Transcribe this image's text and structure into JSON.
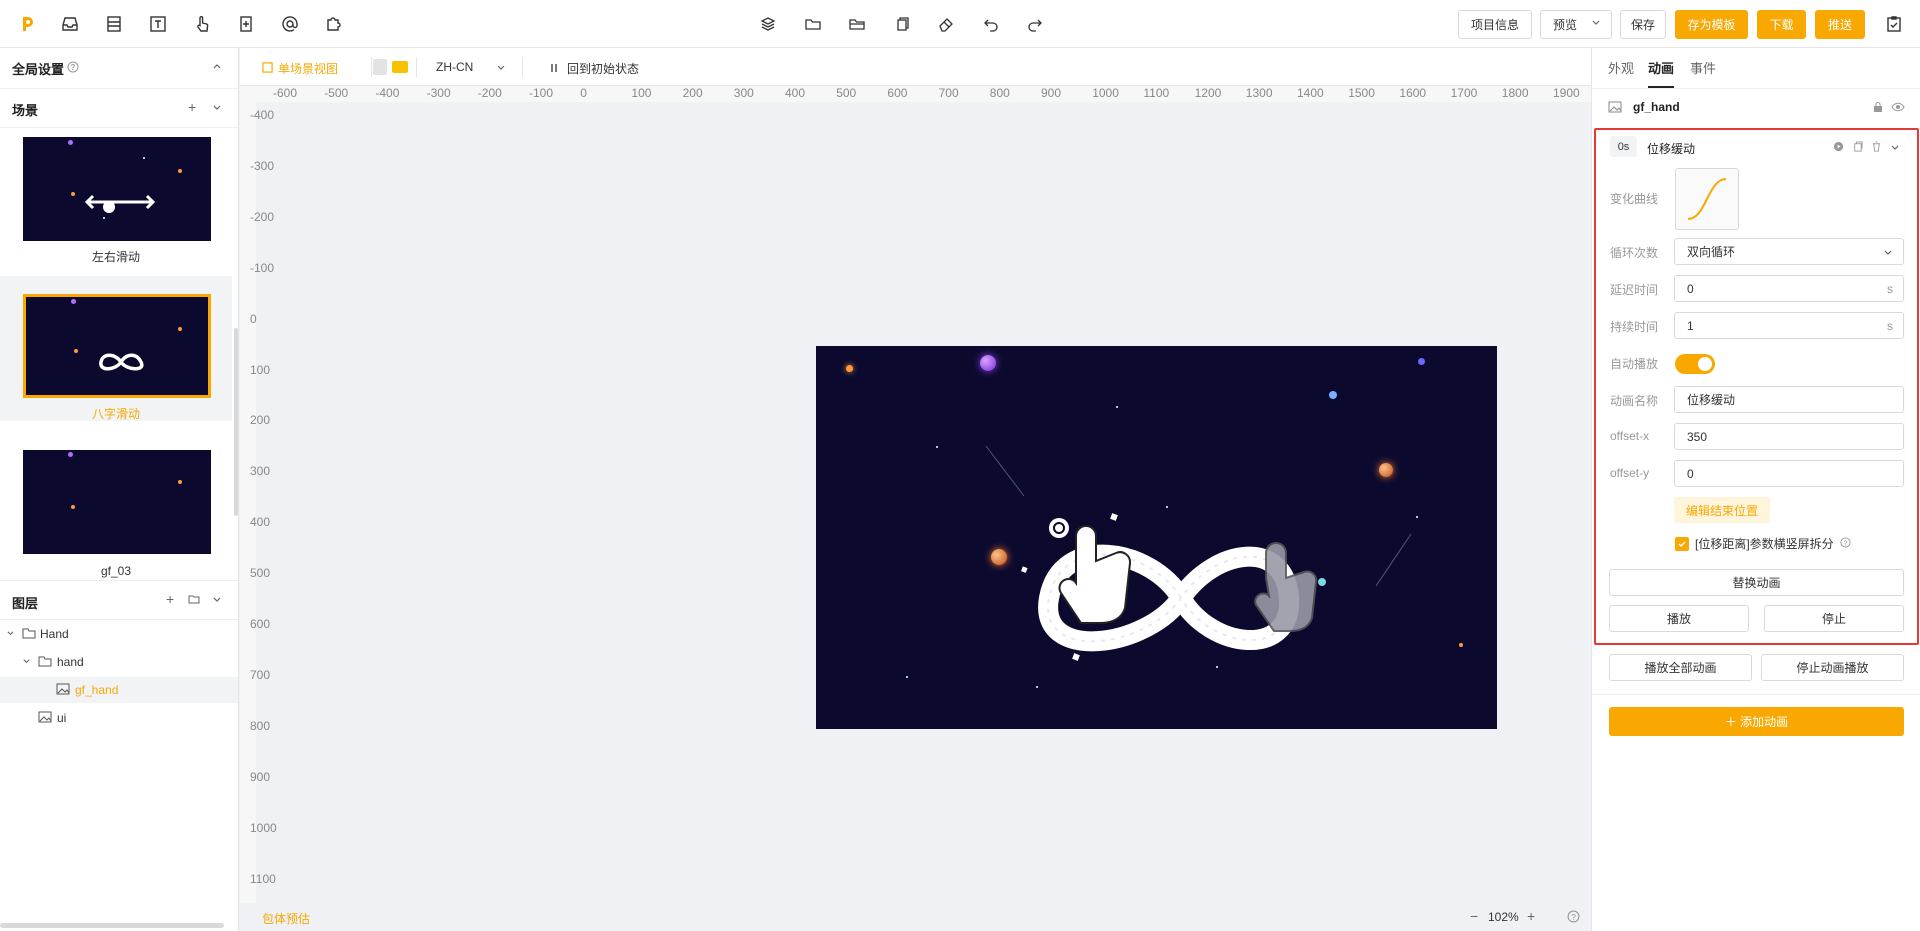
{
  "toolbar": {
    "left_icons": [
      "logo-icon",
      "inbox-icon",
      "layout-icon",
      "text-icon",
      "hand-pointer-icon",
      "add-file-icon",
      "at-icon",
      "puzzle-icon"
    ],
    "center_icons": [
      "layers-icon",
      "folder-icon",
      "folder-open-icon",
      "copy-icon",
      "eraser-icon",
      "undo-icon",
      "redo-icon"
    ],
    "project_info": "项目信息",
    "preview": "预览",
    "save": "保存",
    "save_template": "存为模板",
    "download": "下载",
    "push": "推送",
    "accent": "#f8a800"
  },
  "left": {
    "global_settings": "全局设置",
    "scenes_title": "场景",
    "scenes": [
      {
        "label": "左右滑动"
      },
      {
        "label": "八字滑动"
      },
      {
        "label": "gf_03"
      }
    ],
    "layers_title": "图层",
    "layers": [
      {
        "label": "Hand"
      },
      {
        "label": "hand"
      },
      {
        "label": "gf_hand"
      },
      {
        "label": "ui"
      }
    ]
  },
  "canvas": {
    "single_view": "单场景视图",
    "language": "ZH-CN",
    "reset": "回到初始状态",
    "ruler_x": [
      "-600",
      "-500",
      "-400",
      "-300",
      "-200",
      "-100",
      "0",
      "100",
      "200",
      "300",
      "400",
      "500",
      "600",
      "700",
      "800",
      "900",
      "1000",
      "1100",
      "1200",
      "1300",
      "1400",
      "1500",
      "1600",
      "1700",
      "1800",
      "1900"
    ],
    "ruler_y": [
      "-400",
      "-300",
      "-200",
      "-100",
      "0",
      "100",
      "200",
      "300",
      "400",
      "500",
      "600",
      "700",
      "800",
      "900",
      "1000",
      "1100"
    ],
    "package_estimate": "包体预估",
    "zoom": "102%"
  },
  "right": {
    "tabs": [
      "外观",
      "动画",
      "事件"
    ],
    "layer_name": "gf_hand",
    "anim_time": "0s",
    "anim_title": "位移缓动",
    "labels": {
      "curve": "变化曲线",
      "loop": "循环次数",
      "delay": "延迟时间",
      "duration": "持续时间",
      "autoplay": "自动播放",
      "name": "动画名称",
      "offset_x": "offset-x",
      "offset_y": "offset-y"
    },
    "values": {
      "loop": "双向循环",
      "delay": "0",
      "duration": "1",
      "unit": "s",
      "name": "位移缓动",
      "offset_x": "350",
      "offset_y": "0",
      "autoplay": true
    },
    "edit_end": "编辑结束位置",
    "split_check": "[位移距离]参数横竖屏拆分",
    "replace": "替换动画",
    "play": "播放",
    "stop": "停止",
    "play_all": "播放全部动画",
    "stop_all": "停止动画播放",
    "add_anim": "＋ 添加动画"
  }
}
